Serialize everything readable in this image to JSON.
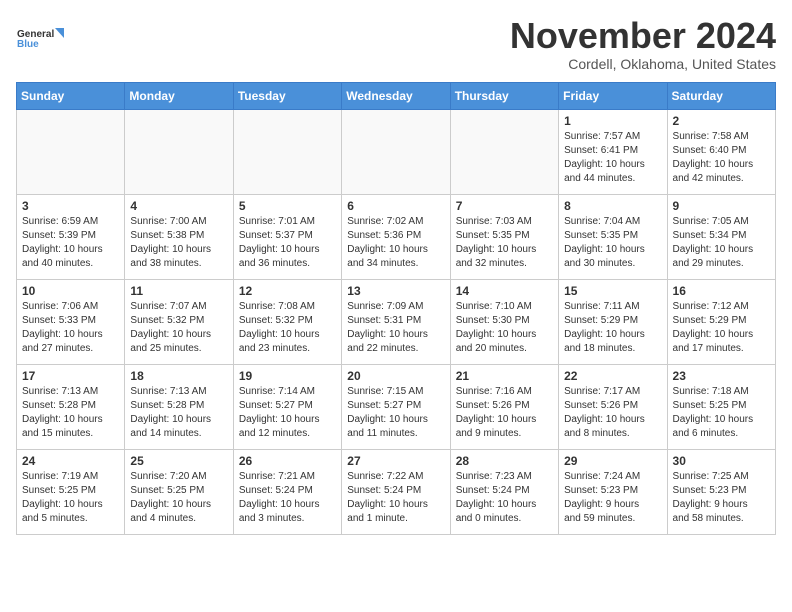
{
  "logo": {
    "line1": "General",
    "line2": "Blue"
  },
  "title": "November 2024",
  "location": "Cordell, Oklahoma, United States",
  "weekdays": [
    "Sunday",
    "Monday",
    "Tuesday",
    "Wednesday",
    "Thursday",
    "Friday",
    "Saturday"
  ],
  "weeks": [
    [
      {
        "day": "",
        "info": ""
      },
      {
        "day": "",
        "info": ""
      },
      {
        "day": "",
        "info": ""
      },
      {
        "day": "",
        "info": ""
      },
      {
        "day": "",
        "info": ""
      },
      {
        "day": "1",
        "info": "Sunrise: 7:57 AM\nSunset: 6:41 PM\nDaylight: 10 hours\nand 44 minutes."
      },
      {
        "day": "2",
        "info": "Sunrise: 7:58 AM\nSunset: 6:40 PM\nDaylight: 10 hours\nand 42 minutes."
      }
    ],
    [
      {
        "day": "3",
        "info": "Sunrise: 6:59 AM\nSunset: 5:39 PM\nDaylight: 10 hours\nand 40 minutes."
      },
      {
        "day": "4",
        "info": "Sunrise: 7:00 AM\nSunset: 5:38 PM\nDaylight: 10 hours\nand 38 minutes."
      },
      {
        "day": "5",
        "info": "Sunrise: 7:01 AM\nSunset: 5:37 PM\nDaylight: 10 hours\nand 36 minutes."
      },
      {
        "day": "6",
        "info": "Sunrise: 7:02 AM\nSunset: 5:36 PM\nDaylight: 10 hours\nand 34 minutes."
      },
      {
        "day": "7",
        "info": "Sunrise: 7:03 AM\nSunset: 5:35 PM\nDaylight: 10 hours\nand 32 minutes."
      },
      {
        "day": "8",
        "info": "Sunrise: 7:04 AM\nSunset: 5:35 PM\nDaylight: 10 hours\nand 30 minutes."
      },
      {
        "day": "9",
        "info": "Sunrise: 7:05 AM\nSunset: 5:34 PM\nDaylight: 10 hours\nand 29 minutes."
      }
    ],
    [
      {
        "day": "10",
        "info": "Sunrise: 7:06 AM\nSunset: 5:33 PM\nDaylight: 10 hours\nand 27 minutes."
      },
      {
        "day": "11",
        "info": "Sunrise: 7:07 AM\nSunset: 5:32 PM\nDaylight: 10 hours\nand 25 minutes."
      },
      {
        "day": "12",
        "info": "Sunrise: 7:08 AM\nSunset: 5:32 PM\nDaylight: 10 hours\nand 23 minutes."
      },
      {
        "day": "13",
        "info": "Sunrise: 7:09 AM\nSunset: 5:31 PM\nDaylight: 10 hours\nand 22 minutes."
      },
      {
        "day": "14",
        "info": "Sunrise: 7:10 AM\nSunset: 5:30 PM\nDaylight: 10 hours\nand 20 minutes."
      },
      {
        "day": "15",
        "info": "Sunrise: 7:11 AM\nSunset: 5:29 PM\nDaylight: 10 hours\nand 18 minutes."
      },
      {
        "day": "16",
        "info": "Sunrise: 7:12 AM\nSunset: 5:29 PM\nDaylight: 10 hours\nand 17 minutes."
      }
    ],
    [
      {
        "day": "17",
        "info": "Sunrise: 7:13 AM\nSunset: 5:28 PM\nDaylight: 10 hours\nand 15 minutes."
      },
      {
        "day": "18",
        "info": "Sunrise: 7:13 AM\nSunset: 5:28 PM\nDaylight: 10 hours\nand 14 minutes."
      },
      {
        "day": "19",
        "info": "Sunrise: 7:14 AM\nSunset: 5:27 PM\nDaylight: 10 hours\nand 12 minutes."
      },
      {
        "day": "20",
        "info": "Sunrise: 7:15 AM\nSunset: 5:27 PM\nDaylight: 10 hours\nand 11 minutes."
      },
      {
        "day": "21",
        "info": "Sunrise: 7:16 AM\nSunset: 5:26 PM\nDaylight: 10 hours\nand 9 minutes."
      },
      {
        "day": "22",
        "info": "Sunrise: 7:17 AM\nSunset: 5:26 PM\nDaylight: 10 hours\nand 8 minutes."
      },
      {
        "day": "23",
        "info": "Sunrise: 7:18 AM\nSunset: 5:25 PM\nDaylight: 10 hours\nand 6 minutes."
      }
    ],
    [
      {
        "day": "24",
        "info": "Sunrise: 7:19 AM\nSunset: 5:25 PM\nDaylight: 10 hours\nand 5 minutes."
      },
      {
        "day": "25",
        "info": "Sunrise: 7:20 AM\nSunset: 5:25 PM\nDaylight: 10 hours\nand 4 minutes."
      },
      {
        "day": "26",
        "info": "Sunrise: 7:21 AM\nSunset: 5:24 PM\nDaylight: 10 hours\nand 3 minutes."
      },
      {
        "day": "27",
        "info": "Sunrise: 7:22 AM\nSunset: 5:24 PM\nDaylight: 10 hours\nand 1 minute."
      },
      {
        "day": "28",
        "info": "Sunrise: 7:23 AM\nSunset: 5:24 PM\nDaylight: 10 hours\nand 0 minutes."
      },
      {
        "day": "29",
        "info": "Sunrise: 7:24 AM\nSunset: 5:23 PM\nDaylight: 9 hours\nand 59 minutes."
      },
      {
        "day": "30",
        "info": "Sunrise: 7:25 AM\nSunset: 5:23 PM\nDaylight: 9 hours\nand 58 minutes."
      }
    ]
  ]
}
